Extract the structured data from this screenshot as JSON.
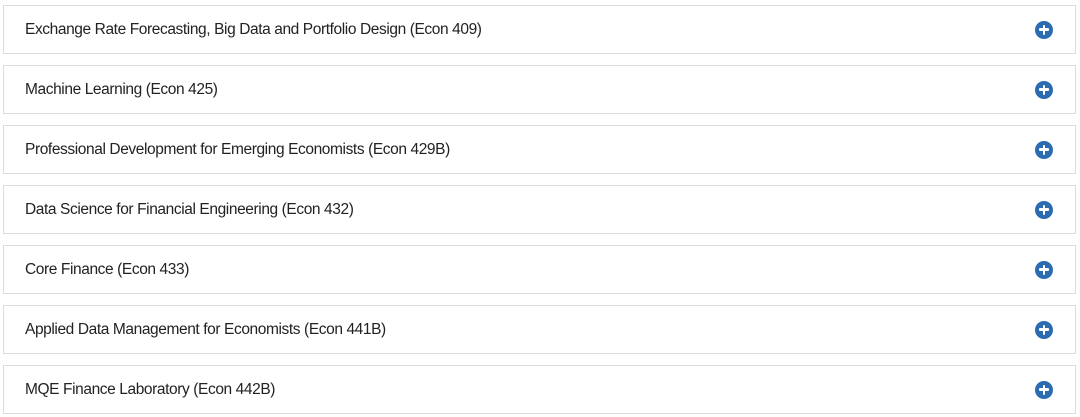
{
  "accordion": {
    "accent_color": "#2b6cb0",
    "items": [
      {
        "label": "Exchange Rate Forecasting, Big Data and Portfolio Design (Econ 409)",
        "icon": "plus-circle-icon"
      },
      {
        "label": "Machine Learning (Econ 425)",
        "icon": "plus-circle-icon"
      },
      {
        "label": "Professional Development for Emerging Economists (Econ 429B)",
        "icon": "plus-circle-icon"
      },
      {
        "label": "Data Science for Financial Engineering (Econ 432)",
        "icon": "plus-circle-icon"
      },
      {
        "label": "Core Finance (Econ 433)",
        "icon": "plus-circle-icon"
      },
      {
        "label": "Applied Data Management for Economists (Econ 441B)",
        "icon": "plus-circle-icon"
      },
      {
        "label": "MQE Finance Laboratory (Econ 442B)",
        "icon": "plus-circle-icon"
      }
    ]
  }
}
